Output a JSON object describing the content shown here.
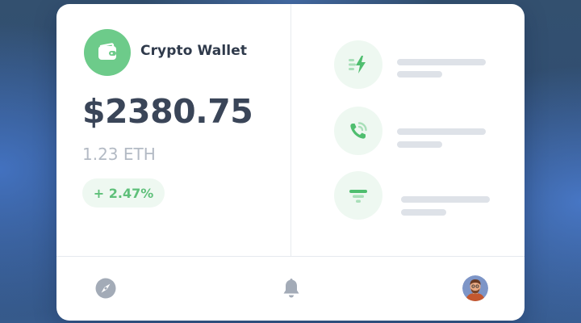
{
  "wallet": {
    "title": "Crypto Wallet",
    "icon": "wallet-icon",
    "balance": "$2380.75",
    "crypto_amount": "1.23 ETH",
    "change": "+ 2.47%"
  },
  "actions": [
    {
      "icon": "fast-transfer-icon"
    },
    {
      "icon": "phone-call-icon"
    },
    {
      "icon": "filter-icon"
    }
  ],
  "bottom_nav": {
    "items": [
      {
        "icon": "compass-icon"
      },
      {
        "icon": "bell-icon"
      },
      {
        "icon": "avatar"
      }
    ]
  },
  "colors": {
    "accent_green": "#6dcb8a",
    "positive_text": "#5fc07a",
    "card_background": "#ffffff",
    "heading_text": "#2f3a4b",
    "muted_text": "#b3bac4",
    "icon_gray": "#9ea6b2",
    "skeleton_line": "#dee2e8"
  }
}
